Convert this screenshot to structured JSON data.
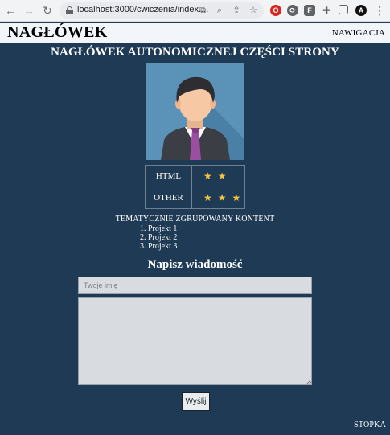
{
  "browser": {
    "url": "localhost:3000/cwiczenia/index...."
  },
  "header": {
    "logo": "NAGŁÓWEK",
    "nav": "NAWIGACJA"
  },
  "section": {
    "title": "NAGŁÓWEK AUTONOMICZNEJ CZĘŚCI STRONY"
  },
  "skills": [
    {
      "name": "HTML",
      "stars": "★ ★",
      "rating": 2
    },
    {
      "name": "OTHER",
      "stars": "★ ★ ★",
      "rating": 3
    }
  ],
  "content": {
    "group_title": "TEMATYCZNIE ZGRUPOWANY KONTENT",
    "projects": [
      "1. Projekt 1",
      "2. Projekt 2",
      "3. Projekt 3"
    ]
  },
  "form": {
    "title": "Napisz wiadomość",
    "name_placeholder": "Twoje imię",
    "message_value": "",
    "send_label": "Wyślij"
  },
  "footer": {
    "text": "STOPKA"
  },
  "colors": {
    "page_bg": "#1f3a55",
    "header_bg": "#f2f6fa",
    "avatar_bg": "#5b93b8",
    "star": "#f5c242"
  }
}
